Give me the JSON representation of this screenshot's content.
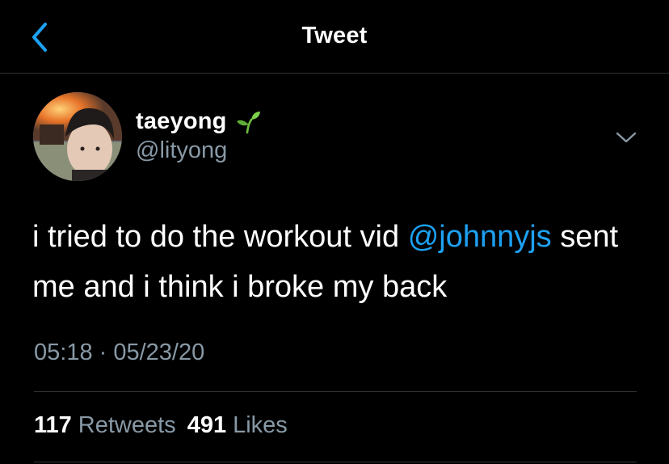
{
  "header": {
    "title": "Tweet",
    "back_icon": "chevron-left-icon"
  },
  "author": {
    "display_name": "taeyong",
    "handle": "@lityong",
    "name_emoji": "seedling-icon",
    "avatar": "avatar-photo"
  },
  "tweet": {
    "text_before": "i tried to do the workout vid ",
    "mention": "@johnnyjs",
    "text_after": " sent me and i think i broke my back",
    "timestamp": "05:18 · 05/23/20"
  },
  "stats": {
    "retweets_count": "117",
    "retweets_label": "Retweets",
    "likes_count": "491",
    "likes_label": "Likes"
  },
  "colors": {
    "background": "#000000",
    "text": "#ffffff",
    "secondary_text": "#8899a6",
    "accent": "#1da1f2",
    "divider": "#2f3336"
  }
}
